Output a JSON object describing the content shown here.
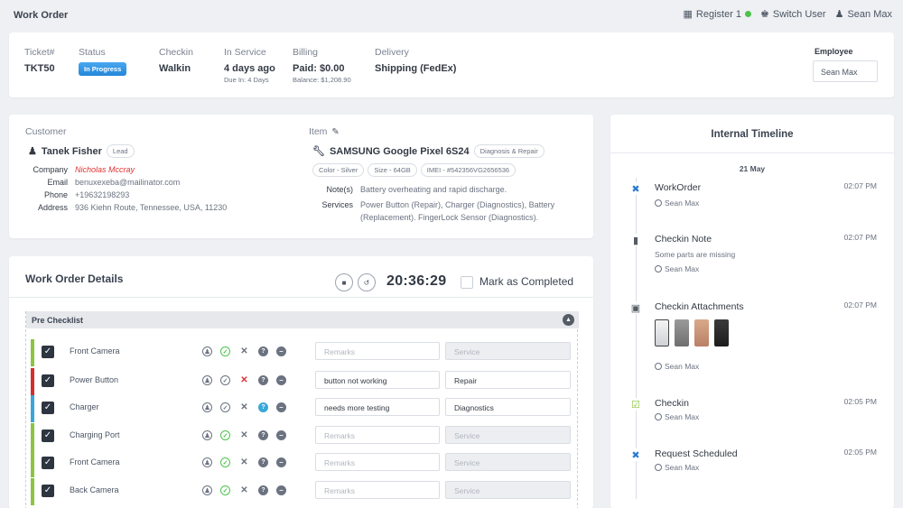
{
  "page": {
    "title": "Work Order"
  },
  "topnav": {
    "register": "Register 1",
    "switch_user": "Switch User",
    "user": "Sean Max"
  },
  "ticket": {
    "ticket_label": "Ticket#",
    "ticket_value": "TKT50",
    "status_label": "Status",
    "status_value": "In Progress",
    "checkin_label": "Checkin",
    "checkin_value": "Walkin",
    "service_label": "In Service",
    "service_value": "4 days ago",
    "service_sub": "Due In: 4 Days",
    "billing_label": "Billing",
    "billing_value": "Paid: $0.00",
    "billing_sub": "Balance: $1,208.90",
    "delivery_label": "Delivery",
    "delivery_value": "Shipping (FedEx)",
    "employee_label": "Employee",
    "employee_value": "Sean Max"
  },
  "customer": {
    "section_label": "Customer",
    "name": "Tanek Fisher",
    "tag": "Lead",
    "fields": [
      {
        "k": "Company",
        "v": "Nicholas Mccray"
      },
      {
        "k": "Email",
        "v": "benuxexeba@mailinator.com"
      },
      {
        "k": "Phone",
        "v": "+19632198293"
      },
      {
        "k": "Address",
        "v": "936 Kiehn Route, Tennessee, USA, 11230"
      }
    ]
  },
  "item": {
    "section_label": "Item",
    "name": "SAMSUNG Google Pixel 6S24",
    "tag": "Diagnosis & Repair",
    "tags": [
      "Color - Silver",
      "Size - 64GB",
      "IMEI - #542356VG2656536"
    ],
    "notes_label": "Note(s)",
    "notes_value": "Battery overheating and rapid discharge.",
    "services_label": "Services",
    "services_value": "Power Button (Repair), Charger (Diagnostics), Battery (Replacement). FingerLock Sensor (Diagnostics)."
  },
  "details": {
    "title": "Work Order Details",
    "timer": "20:36:29",
    "mark_completed": "Mark as Completed",
    "checklist_title": "Pre Checklist",
    "rows": [
      {
        "name": "Front Camera",
        "bar": "#8bc53f",
        "state": "ok",
        "remarks": "",
        "remarks_ph": "Remarks",
        "service": "",
        "service_ph": "Service"
      },
      {
        "name": "Power Button",
        "bar": "#d32f2f",
        "state": "no",
        "remarks": "button not working",
        "remarks_ph": "Remarks",
        "service": "Repair",
        "service_ph": "Service"
      },
      {
        "name": "Charger",
        "bar": "#3aa7d8",
        "state": "q",
        "remarks": "needs more testing",
        "remarks_ph": "Remarks",
        "service": "Diagnostics",
        "service_ph": "Service"
      },
      {
        "name": "Charging Port",
        "bar": "#8bc53f",
        "state": "ok",
        "remarks": "",
        "remarks_ph": "Remarks",
        "service": "",
        "service_ph": "Service"
      },
      {
        "name": "Front Camera",
        "bar": "#8bc53f",
        "state": "ok",
        "remarks": "",
        "remarks_ph": "Remarks",
        "service": "",
        "service_ph": "Service"
      },
      {
        "name": "Back Camera",
        "bar": "#8bc53f",
        "state": "ok",
        "remarks": "",
        "remarks_ph": "Remarks",
        "service": "",
        "service_ph": "Service"
      }
    ]
  },
  "timeline": {
    "title": "Internal Timeline",
    "date": "21 May",
    "events": [
      {
        "title": "WorkOrder",
        "time": "02:07 PM",
        "desc": "",
        "user": "Sean Max",
        "icon": "wrench-icon"
      },
      {
        "title": "Checkin Note",
        "time": "02:07 PM",
        "desc": "Some parts are missing",
        "user": "Sean Max",
        "icon": "note-icon"
      },
      {
        "title": "Checkin Attachments",
        "time": "02:07 PM",
        "desc": "",
        "user": "Sean Max",
        "icon": "images-icon"
      },
      {
        "title": "Checkin",
        "time": "02:05 PM",
        "desc": "",
        "user": "Sean Max",
        "icon": "calendar-check-icon"
      },
      {
        "title": "Request Scheduled",
        "time": "02:05 PM",
        "desc": "",
        "user": "Sean Max",
        "icon": "wrench-icon"
      }
    ]
  },
  "colors": {
    "accent": "#2386d8",
    "online": "#4cc24c",
    "ok": "#4cc24c",
    "no": "#e03030",
    "q": "#3aa7d8"
  }
}
